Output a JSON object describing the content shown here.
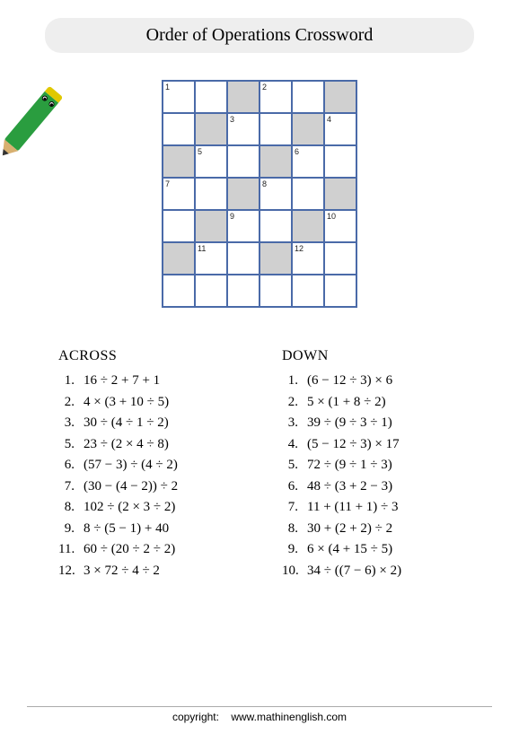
{
  "title": "Order of Operations Crossword",
  "grid": {
    "cols": 6,
    "rows": 7,
    "cells": [
      {
        "r": 0,
        "c": 0,
        "dark": false,
        "num": "1"
      },
      {
        "r": 0,
        "c": 1,
        "dark": false,
        "num": ""
      },
      {
        "r": 0,
        "c": 2,
        "dark": true,
        "num": ""
      },
      {
        "r": 0,
        "c": 3,
        "dark": false,
        "num": "2"
      },
      {
        "r": 0,
        "c": 4,
        "dark": false,
        "num": ""
      },
      {
        "r": 0,
        "c": 5,
        "dark": true,
        "num": ""
      },
      {
        "r": 1,
        "c": 0,
        "dark": false,
        "num": ""
      },
      {
        "r": 1,
        "c": 1,
        "dark": true,
        "num": ""
      },
      {
        "r": 1,
        "c": 2,
        "dark": false,
        "num": "3"
      },
      {
        "r": 1,
        "c": 3,
        "dark": false,
        "num": ""
      },
      {
        "r": 1,
        "c": 4,
        "dark": true,
        "num": ""
      },
      {
        "r": 1,
        "c": 5,
        "dark": false,
        "num": "4"
      },
      {
        "r": 2,
        "c": 0,
        "dark": true,
        "num": ""
      },
      {
        "r": 2,
        "c": 1,
        "dark": false,
        "num": "5"
      },
      {
        "r": 2,
        "c": 2,
        "dark": false,
        "num": ""
      },
      {
        "r": 2,
        "c": 3,
        "dark": true,
        "num": ""
      },
      {
        "r": 2,
        "c": 4,
        "dark": false,
        "num": "6"
      },
      {
        "r": 2,
        "c": 5,
        "dark": false,
        "num": ""
      },
      {
        "r": 3,
        "c": 0,
        "dark": false,
        "num": "7"
      },
      {
        "r": 3,
        "c": 1,
        "dark": false,
        "num": ""
      },
      {
        "r": 3,
        "c": 2,
        "dark": true,
        "num": ""
      },
      {
        "r": 3,
        "c": 3,
        "dark": false,
        "num": "8"
      },
      {
        "r": 3,
        "c": 4,
        "dark": false,
        "num": ""
      },
      {
        "r": 3,
        "c": 5,
        "dark": true,
        "num": ""
      },
      {
        "r": 4,
        "c": 0,
        "dark": false,
        "num": ""
      },
      {
        "r": 4,
        "c": 1,
        "dark": true,
        "num": ""
      },
      {
        "r": 4,
        "c": 2,
        "dark": false,
        "num": "9"
      },
      {
        "r": 4,
        "c": 3,
        "dark": false,
        "num": ""
      },
      {
        "r": 4,
        "c": 4,
        "dark": true,
        "num": ""
      },
      {
        "r": 4,
        "c": 5,
        "dark": false,
        "num": "10"
      },
      {
        "r": 5,
        "c": 0,
        "dark": true,
        "num": ""
      },
      {
        "r": 5,
        "c": 1,
        "dark": false,
        "num": "11"
      },
      {
        "r": 5,
        "c": 2,
        "dark": false,
        "num": ""
      },
      {
        "r": 5,
        "c": 3,
        "dark": true,
        "num": ""
      },
      {
        "r": 5,
        "c": 4,
        "dark": false,
        "num": "12"
      },
      {
        "r": 5,
        "c": 5,
        "dark": false,
        "num": ""
      },
      {
        "r": 6,
        "c": 0,
        "dark": false,
        "num": ""
      },
      {
        "r": 6,
        "c": 1,
        "dark": false,
        "num": ""
      },
      {
        "r": 6,
        "c": 2,
        "dark": false,
        "num": ""
      },
      {
        "r": 6,
        "c": 3,
        "dark": false,
        "num": ""
      },
      {
        "r": 6,
        "c": 4,
        "dark": false,
        "num": ""
      },
      {
        "r": 6,
        "c": 5,
        "dark": false,
        "num": ""
      }
    ]
  },
  "clues": {
    "across_header": "ACROSS",
    "down_header": "DOWN",
    "across": [
      {
        "n": "1.",
        "t": "16 ÷ 2 + 7 + 1"
      },
      {
        "n": "2.",
        "t": "4 × (3 + 10 ÷ 5)"
      },
      {
        "n": "3.",
        "t": "30 ÷ (4 ÷ 1 ÷ 2)"
      },
      {
        "n": "5.",
        "t": "23 ÷ (2 × 4 ÷ 8)"
      },
      {
        "n": "6.",
        "t": "(57 − 3) ÷ (4 ÷ 2)"
      },
      {
        "n": "7.",
        "t": "(30 − (4 − 2)) ÷ 2"
      },
      {
        "n": "8.",
        "t": "102 ÷ (2 × 3 ÷ 2)"
      },
      {
        "n": "9.",
        "t": "8 ÷ (5 − 1) + 40"
      },
      {
        "n": "11.",
        "t": "60 ÷ (20 ÷ 2 ÷ 2)"
      },
      {
        "n": "12.",
        "t": "3 × 72 ÷ 4 ÷ 2"
      }
    ],
    "down": [
      {
        "n": "1.",
        "t": "(6 − 12 ÷ 3) × 6"
      },
      {
        "n": "2.",
        "t": "5 × (1 + 8 ÷ 2)"
      },
      {
        "n": "3.",
        "t": "39 ÷ (9 ÷ 3 ÷ 1)"
      },
      {
        "n": "4.",
        "t": "(5 − 12 ÷ 3) × 17"
      },
      {
        "n": "5.",
        "t": "72 ÷ (9 ÷ 1 ÷ 3)"
      },
      {
        "n": "6.",
        "t": "48 ÷ (3 + 2 − 3)"
      },
      {
        "n": "7.",
        "t": "11 + (11 + 1) ÷ 3"
      },
      {
        "n": "8.",
        "t": "30 + (2 + 2) ÷ 2"
      },
      {
        "n": "9.",
        "t": "6 × (4 + 15 ÷ 5)"
      },
      {
        "n": "10.",
        "t": "34 ÷ ((7 − 6) × 2)"
      }
    ]
  },
  "footer": {
    "copyright": "copyright:",
    "site": "www.mathinenglish.com"
  }
}
